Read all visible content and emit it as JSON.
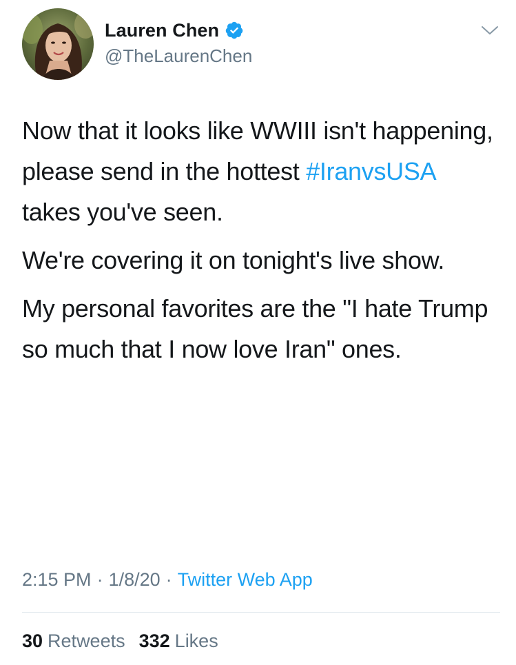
{
  "author": {
    "display_name": "Lauren Chen",
    "handle": "@TheLaurenChen",
    "verified": true,
    "verified_color": "#1da1f2",
    "avatar_icon": "profile-photo"
  },
  "tweet": {
    "paragraphs": [
      {
        "before": "Now that it looks like WWIII isn't happening, please send in the hottest ",
        "hashtag": "#IranvsUSA",
        "after": " takes you've seen."
      },
      {
        "before": "We're covering it on tonight's live show.",
        "hashtag": "",
        "after": ""
      },
      {
        "before": "My personal favorites are the \"I hate Trump so much that I now love Iran\" ones.",
        "hashtag": "",
        "after": ""
      }
    ],
    "time": "2:15 PM",
    "separator": "·",
    "date": "1/8/20",
    "source": "Twitter Web App"
  },
  "stats": {
    "retweets_count": "30",
    "retweets_label": "Retweets",
    "likes_count": "332",
    "likes_label": "Likes"
  },
  "colors": {
    "link": "#1da1f2",
    "text": "#14171a",
    "secondary": "#657786",
    "divider": "#e1e8ed"
  },
  "icons": {
    "verified": "verified-badge-icon",
    "menu": "chevron-down-icon"
  }
}
